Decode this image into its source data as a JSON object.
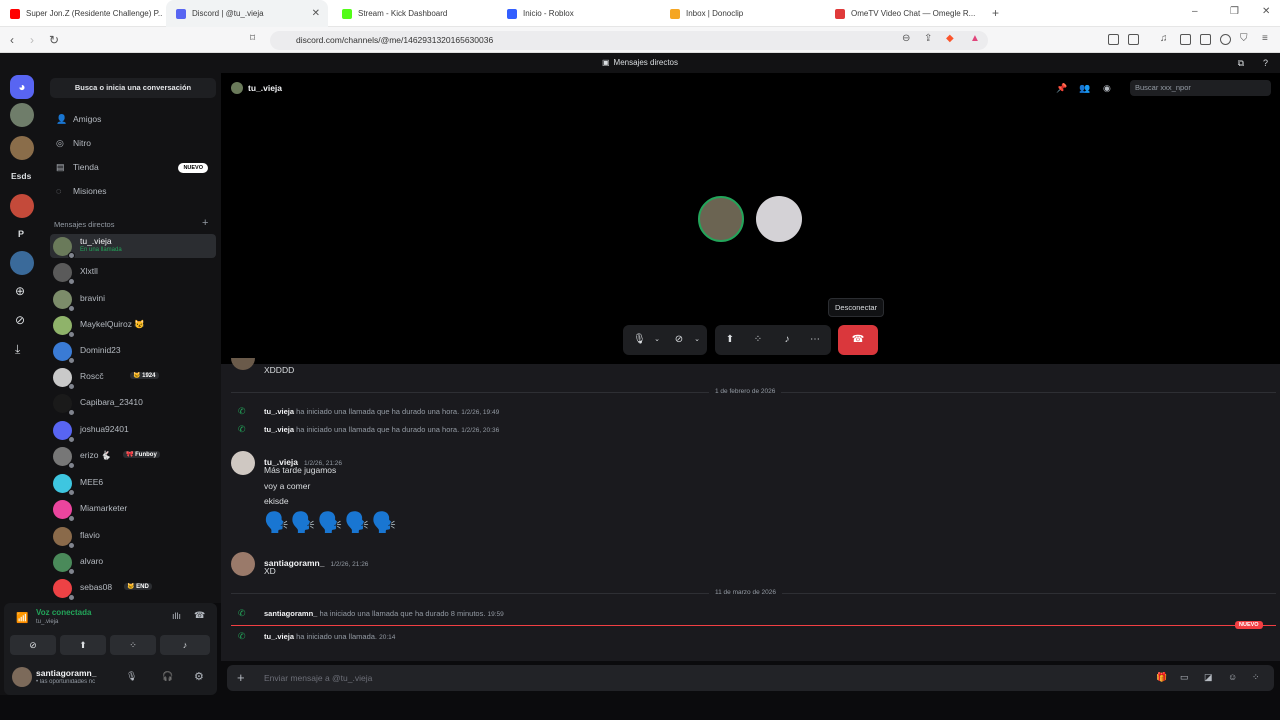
{
  "browser": {
    "tabs": [
      {
        "label": "Super Jon.Z (Residente Challenge) P...",
        "color": "#ff0000"
      },
      {
        "label": "Discord | @tu_.vieja",
        "color": "#5865f2"
      },
      {
        "label": "Stream - Kick Dashboard",
        "color": "#53fc18"
      },
      {
        "label": "Inicio - Roblox",
        "color": "#335fff"
      },
      {
        "label": "Inbox | Donoclip",
        "color": "#f5a623"
      },
      {
        "label": "OmeTV Video Chat — Omegle R...",
        "color": "#e03a3a"
      }
    ],
    "url": "discord.com/channels/@me/1462931320165630036"
  },
  "topbar": {
    "title": "Mensajes directos"
  },
  "sidebar": {
    "search": "Busca o inicia una conversación",
    "nav": [
      {
        "label": "Amigos",
        "icon": "friends-icon"
      },
      {
        "label": "Nitro",
        "icon": "nitro-icon"
      },
      {
        "label": "Tienda",
        "icon": "shop-icon",
        "badge": "NUEVO"
      },
      {
        "label": "Misiones",
        "icon": "quests-icon"
      }
    ],
    "dm_header": "Mensajes directos",
    "dms": [
      {
        "name": "tu_.vieja",
        "sub": "En una llamada",
        "color": "#6a7a5a"
      },
      {
        "name": "Xlxtll",
        "color": "#5a5a5a"
      },
      {
        "name": "bravini",
        "color": "#7c8c6a"
      },
      {
        "name": "MaykelQuiroz 😼",
        "color": "#8fb36a"
      },
      {
        "name": "Dominid23",
        "color": "#3a7bd5"
      },
      {
        "name": "Roscč",
        "tag": "🐱 1924",
        "color": "#c9c9c9"
      },
      {
        "name": "Capibara_23410",
        "color": "#1a1a1a"
      },
      {
        "name": "joshua92401",
        "color": "#5865f2"
      },
      {
        "name": "erizo 🐇",
        "tag": "🎀 Funboy",
        "color": "#777"
      },
      {
        "name": "MEE6",
        "color": "#3ec6e0"
      },
      {
        "name": "Miamarketer",
        "color": "#eb459e"
      },
      {
        "name": "flavio",
        "color": "#8a6a4a"
      },
      {
        "name": "alvaro",
        "color": "#4a8a5a"
      },
      {
        "name": "sebas08",
        "tag": "🐱 END",
        "color": "#ed4245"
      }
    ],
    "voice": {
      "title": "Voz conectada",
      "channel": "tu_.vieja"
    },
    "user": {
      "name": "santiagoramn_",
      "status": "• las oportunidades nc"
    }
  },
  "call": {
    "title": "tu_.vieja",
    "search_placeholder": "Buscar xxx_npor",
    "tooltip": "Desconectar"
  },
  "chat": {
    "prev_message": "XDDDD",
    "date1": "1 de febrero de 2026",
    "calls1": [
      {
        "user": "tu_.vieja",
        "text": "ha iniciado una llamada que ha durado una hora.",
        "time": "1/2/26, 19:49"
      },
      {
        "user": "tu_.vieja",
        "text": "ha iniciado una llamada que ha durado una hora.",
        "time": "1/2/26, 20:36"
      }
    ],
    "msg1": {
      "user": "tu_.vieja",
      "time": "1/2/26, 21:26",
      "lines": [
        "Más tarde jugamos",
        "voy a comer",
        "ekisde"
      ],
      "emoji": "🗣️🗣️🗣️🗣️🗣️"
    },
    "msg2": {
      "user": "santiagoramn_",
      "time": "1/2/26, 21:26",
      "text": "XD"
    },
    "date2": "11 de marzo de 2026",
    "call2": {
      "user": "santiagoramn_",
      "text": "ha iniciado una llamada que ha durado 8 minutos.",
      "time": "19:59"
    },
    "new_badge": "NUEVO",
    "call3": {
      "user": "tu_.vieja",
      "text": "ha iniciado una llamada.",
      "time": "20:14"
    },
    "composer_placeholder": "Enviar mensaje a @tu_.vieja"
  },
  "rail": {
    "label": "Esds",
    "letter": "P"
  }
}
